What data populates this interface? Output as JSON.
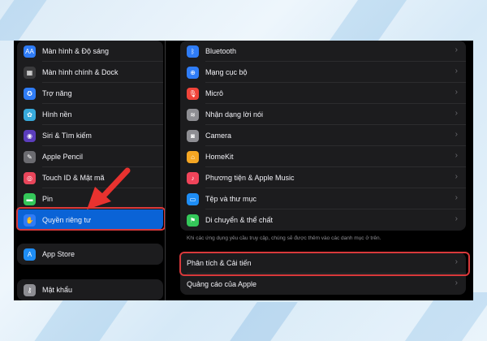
{
  "sidebar": {
    "group1": [
      {
        "label": "Màn hình & Độ sáng",
        "icon": "text-size-icon",
        "color": "#2f7cf6",
        "glyph": "AA"
      },
      {
        "label": "Màn hình chính & Dock",
        "icon": "home-grid-icon",
        "color": "#3a3a3c",
        "glyph": "▦"
      },
      {
        "label": "Trợ năng",
        "icon": "accessibility-icon",
        "color": "#2f7cf6",
        "glyph": "✪"
      },
      {
        "label": "Hình nền",
        "icon": "wallpaper-icon",
        "color": "#37aadc",
        "glyph": "✿"
      },
      {
        "label": "Siri & Tìm kiếm",
        "icon": "siri-icon",
        "color": "#5b3dbd",
        "glyph": "◉"
      },
      {
        "label": "Apple Pencil",
        "icon": "pencil-icon",
        "color": "#6b6b70",
        "glyph": "✎"
      },
      {
        "label": "Touch ID & Mật mã",
        "icon": "fingerprint-icon",
        "color": "#e8455a",
        "glyph": "◎"
      },
      {
        "label": "Pin",
        "icon": "battery-icon",
        "color": "#34c759",
        "glyph": "▬"
      },
      {
        "label": "Quyền riêng tư",
        "icon": "hand-icon",
        "color": "#2f7cf6",
        "glyph": "✋"
      }
    ],
    "group2": [
      {
        "label": "App Store",
        "icon": "app-store-icon",
        "color": "#1e8df5",
        "glyph": "A"
      }
    ],
    "group3": [
      {
        "label": "Mật khẩu",
        "icon": "key-icon",
        "color": "#8e8e93",
        "glyph": "⚷"
      }
    ]
  },
  "main": {
    "group1": [
      {
        "label": "Bluetooth",
        "icon": "bluetooth-icon",
        "color": "#2f7cf6",
        "glyph": "ᛒ"
      },
      {
        "label": "Mạng cục bộ",
        "icon": "network-icon",
        "color": "#2f7cf6",
        "glyph": "⊕"
      },
      {
        "label": "Micrô",
        "icon": "microphone-icon",
        "color": "#f0443a",
        "glyph": "🎙"
      },
      {
        "label": "Nhận dạng lời nói",
        "icon": "waveform-icon",
        "color": "#8e8e93",
        "glyph": "≋"
      },
      {
        "label": "Camera",
        "icon": "camera-icon",
        "color": "#8e8e93",
        "glyph": "◙"
      },
      {
        "label": "HomeKit",
        "icon": "home-icon",
        "color": "#f5a623",
        "glyph": "⌂"
      },
      {
        "label": "Phương tiện & Apple Music",
        "icon": "music-icon",
        "color": "#f0445a",
        "glyph": "♪"
      },
      {
        "label": "Tệp và thư mục",
        "icon": "folder-icon",
        "color": "#1e8df5",
        "glyph": "▭"
      },
      {
        "label": "Di chuyển & thể chất",
        "icon": "fitness-icon",
        "color": "#34c759",
        "glyph": "⚑"
      }
    ],
    "footnote": "Khi các ứng dụng yêu cầu truy cập, chúng sẽ được thêm vào các danh mục ở trên.",
    "group2": [
      {
        "label": "Phân tích & Cải tiến"
      },
      {
        "label": "Quảng cáo của Apple"
      }
    ],
    "chevron": "›"
  },
  "colors": {
    "highlight": "#d8393b",
    "active": "#0a63d6"
  }
}
